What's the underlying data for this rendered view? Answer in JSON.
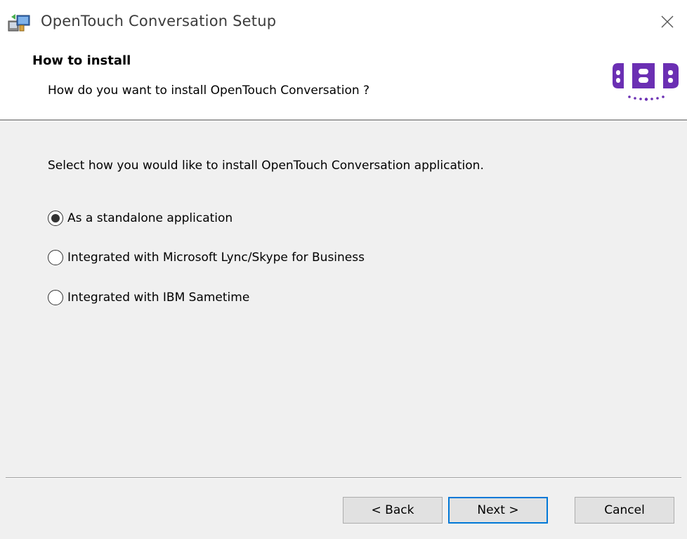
{
  "window": {
    "title": "OpenTouch Conversation Setup"
  },
  "header": {
    "title": "How to install",
    "subtitle": "How do you want to install OpenTouch Conversation ?",
    "logo_icon": "opentouch-logo-icon"
  },
  "body": {
    "instruction": "Select how you would like to install OpenTouch Conversation application.",
    "options": [
      {
        "label": "As a standalone application",
        "selected": true
      },
      {
        "label": "Integrated with Microsoft Lync/Skype for Business",
        "selected": false
      },
      {
        "label": "Integrated with IBM Sametime",
        "selected": false
      }
    ]
  },
  "buttons": {
    "back": "< Back",
    "next": "Next >",
    "cancel": "Cancel"
  },
  "colors": {
    "brand": "#6b2fb3",
    "focus": "#0078d7",
    "background": "#f0f0f0"
  }
}
